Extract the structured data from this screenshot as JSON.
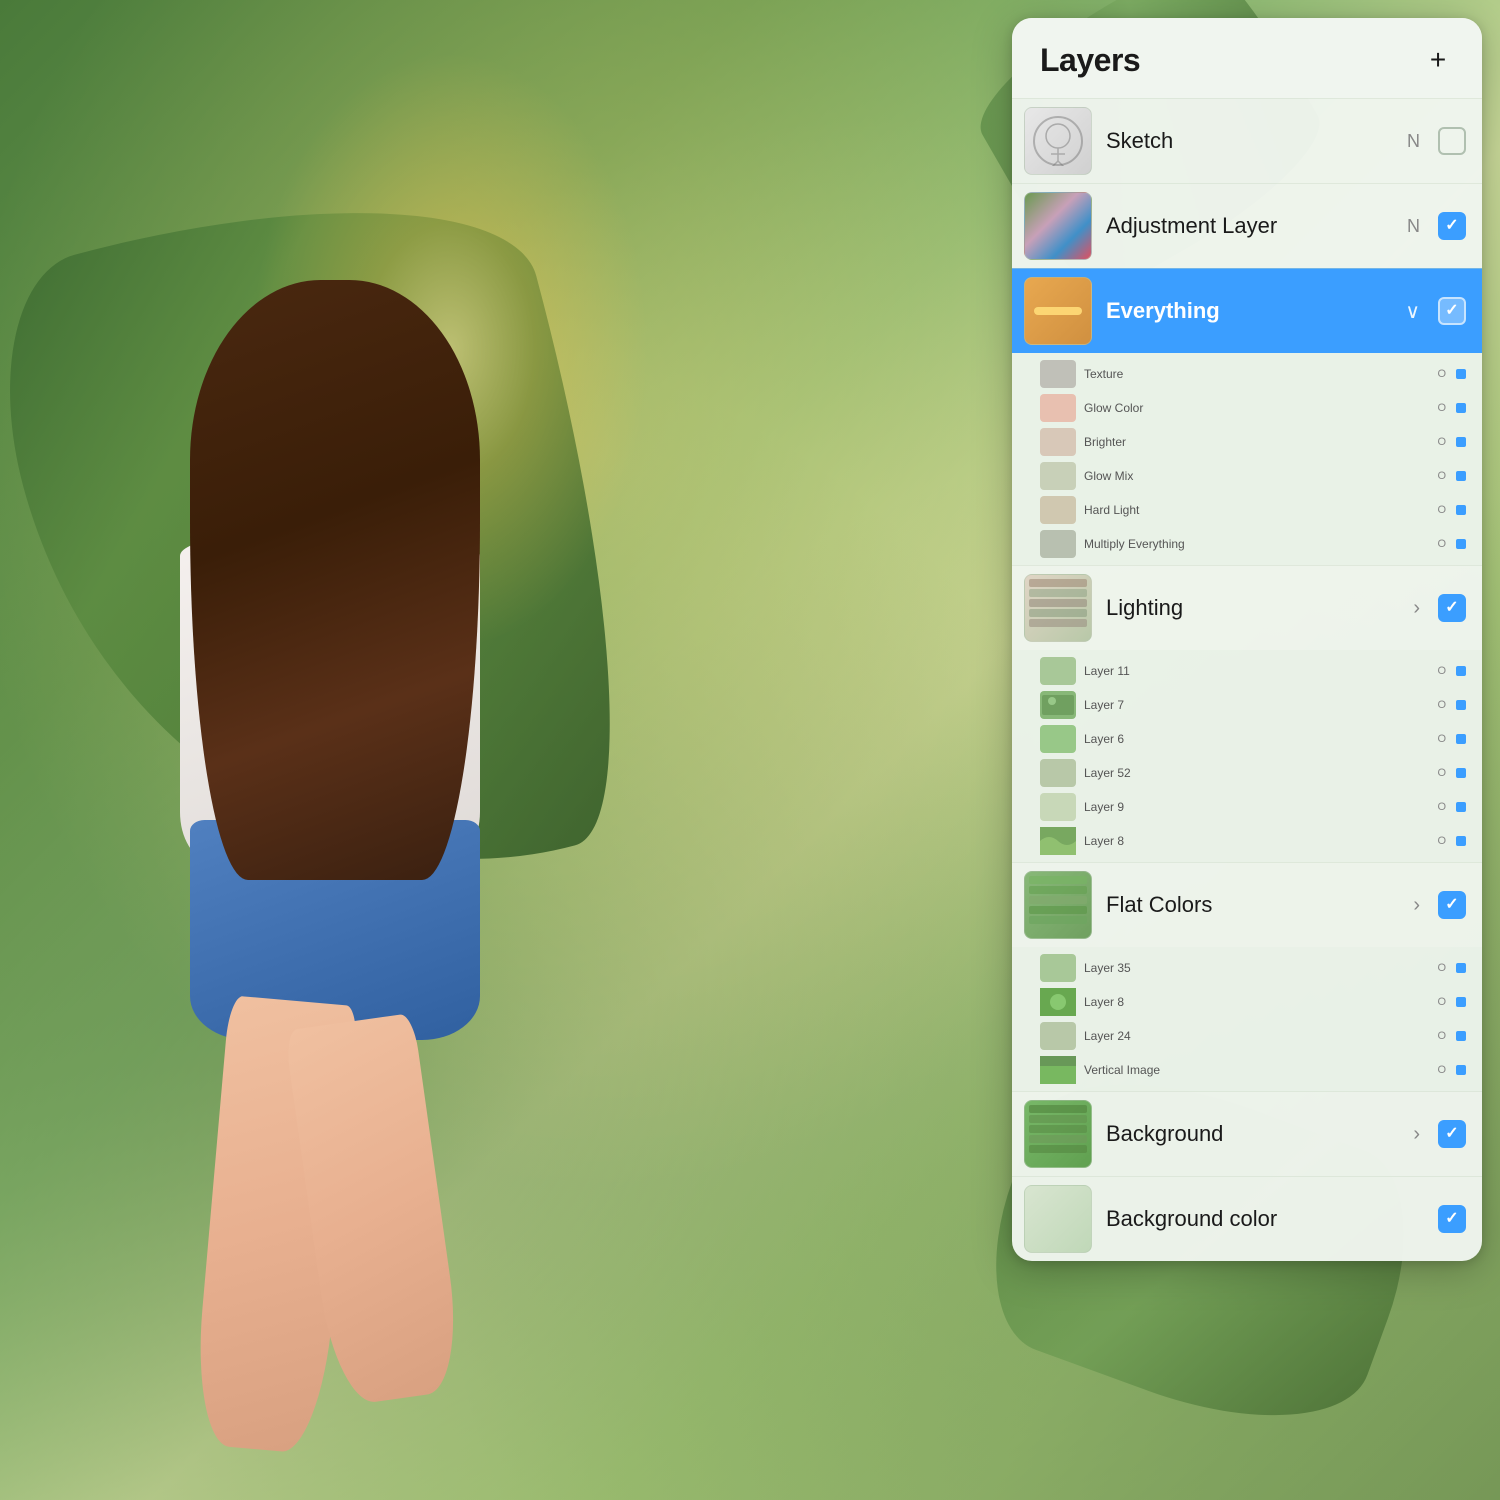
{
  "panel": {
    "title": "Layers",
    "add_button": "+",
    "layers": [
      {
        "id": "sketch",
        "name": "Sketch",
        "mode": "N",
        "checked": false,
        "active": false,
        "thumbnail_type": "sketch",
        "has_chevron": false,
        "chevron_type": "none"
      },
      {
        "id": "adjustment-layer",
        "name": "Adjustment Layer",
        "mode": "N",
        "checked": true,
        "active": false,
        "thumbnail_type": "adjustment",
        "has_chevron": false,
        "chevron_type": "none"
      },
      {
        "id": "everything",
        "name": "Everything",
        "mode": "",
        "checked": true,
        "active": true,
        "thumbnail_type": "everything",
        "has_chevron": true,
        "chevron_type": "down",
        "sublayers": [
          {
            "name": "Texture",
            "mode": "O",
            "checked": true,
            "color": "#c0c0b8"
          },
          {
            "name": "Glow Color",
            "mode": "O",
            "checked": true,
            "color": "#e8c0b0"
          },
          {
            "name": "Brighter",
            "mode": "O",
            "checked": true,
            "color": "#d8c8b8"
          },
          {
            "name": "Glow Mix",
            "mode": "O",
            "checked": true,
            "color": "#c8d0b8"
          },
          {
            "name": "Hard Light",
            "mode": "O",
            "checked": true,
            "color": "#d0c8b0"
          },
          {
            "name": "Multiply Everything",
            "mode": "O",
            "checked": true,
            "color": "#b8c0b0"
          }
        ]
      },
      {
        "id": "lighting",
        "name": "Lighting",
        "mode": "",
        "checked": true,
        "active": false,
        "thumbnail_type": "lighting",
        "has_chevron": true,
        "chevron_type": "right",
        "sublayers": [
          {
            "name": "Layer 11",
            "mode": "O",
            "checked": true,
            "color": "#d0c8b8"
          },
          {
            "name": "Layer 7",
            "mode": "O",
            "checked": true,
            "color": "#b8c0b0"
          },
          {
            "name": "Layer 6",
            "mode": "O",
            "checked": true,
            "color": "#c8d0b8"
          },
          {
            "name": "Layer 52",
            "mode": "O",
            "checked": true,
            "color": "#c0b8a8"
          },
          {
            "name": "Layer 9",
            "mode": "O",
            "checked": true,
            "color": "#d8c0b0"
          },
          {
            "name": "Layer 8",
            "mode": "O",
            "checked": true,
            "color": "#b0c8b8"
          }
        ]
      },
      {
        "id": "flat-colors",
        "name": "Flat Colors",
        "mode": "",
        "checked": true,
        "active": false,
        "thumbnail_type": "flatcolors",
        "has_chevron": true,
        "chevron_type": "right",
        "sublayers": [
          {
            "name": "Layer 35",
            "mode": "O",
            "checked": true,
            "color": "#a8c898"
          },
          {
            "name": "Layer 8",
            "mode": "O",
            "checked": true,
            "color": "#98b888"
          },
          {
            "name": "Layer 24",
            "mode": "O",
            "checked": true,
            "color": "#b8c8a8"
          },
          {
            "name": "Vertical Image",
            "mode": "O",
            "checked": true,
            "color": "#88a878"
          }
        ]
      },
      {
        "id": "background",
        "name": "Background",
        "mode": "",
        "checked": true,
        "active": false,
        "thumbnail_type": "background",
        "has_chevron": true,
        "chevron_type": "right",
        "sublayers": []
      },
      {
        "id": "background-color",
        "name": "Background color",
        "mode": "",
        "checked": true,
        "active": false,
        "thumbnail_type": "bgcolor",
        "has_chevron": false,
        "chevron_type": "none"
      }
    ]
  },
  "colors": {
    "active_blue": "#3b9eff",
    "panel_bg": "rgba(240,245,238,0.97)",
    "text_primary": "#1a1a1a",
    "text_secondary": "#888888"
  }
}
